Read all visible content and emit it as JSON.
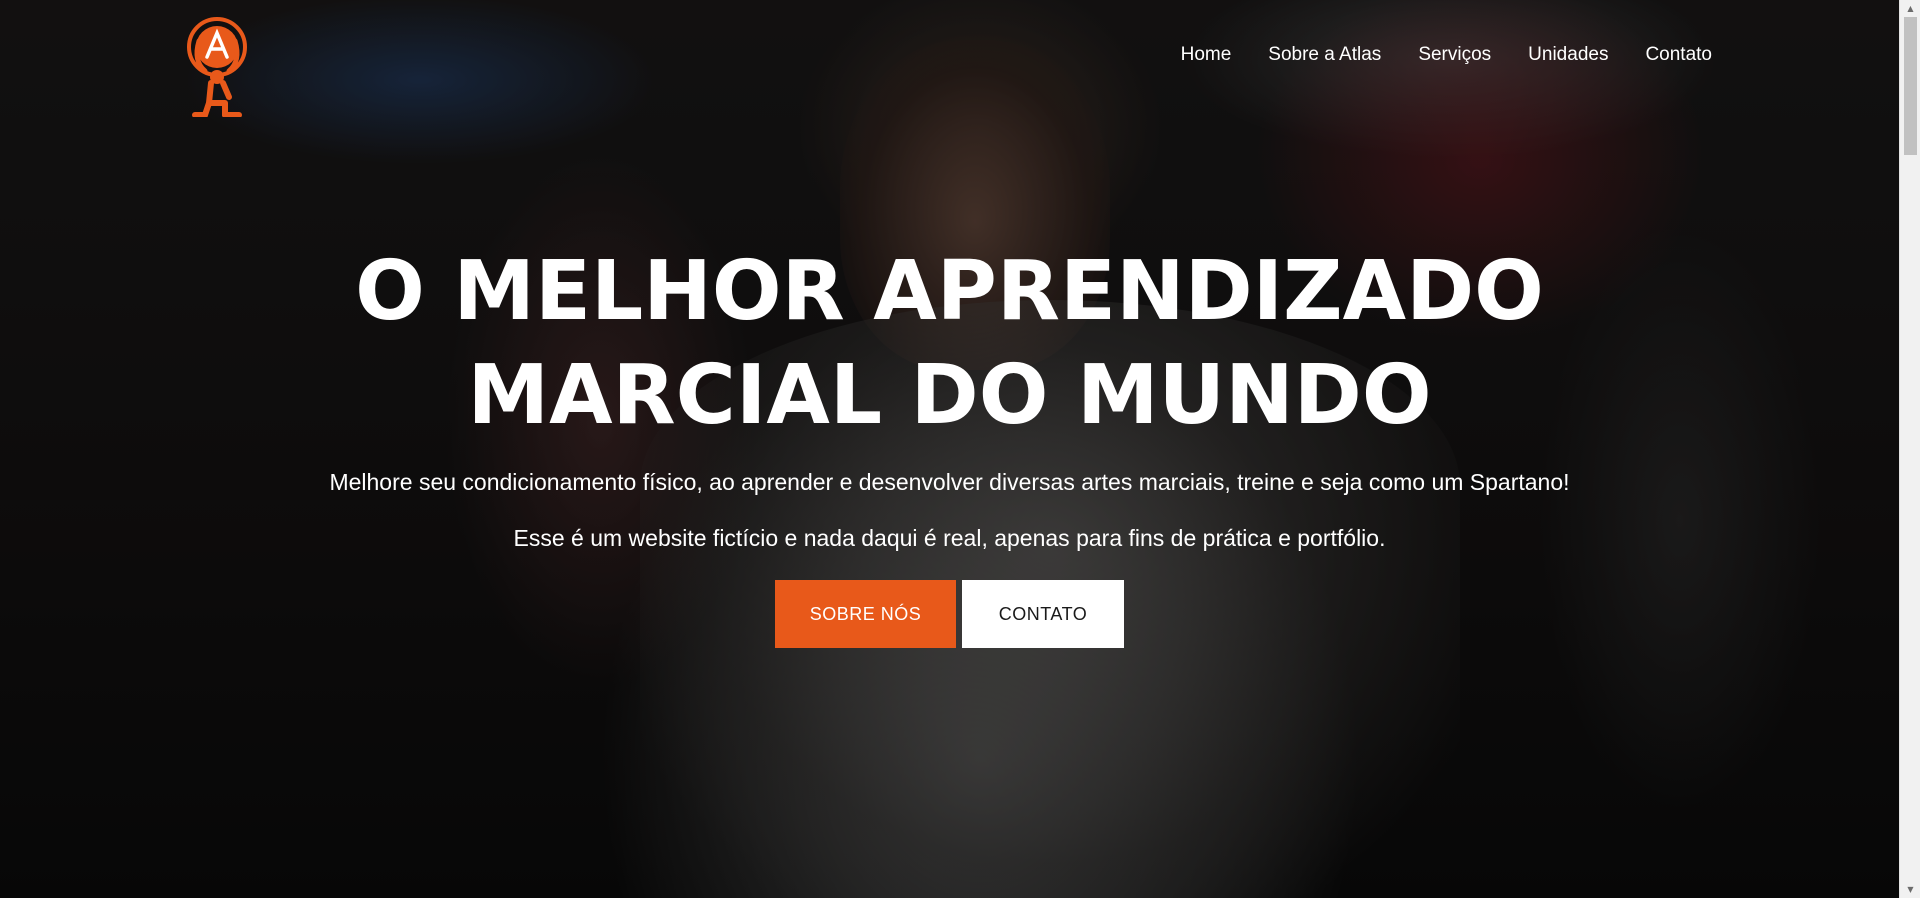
{
  "brand": {
    "logo_icon": "atlas-figure-logo-icon",
    "accent_color": "#e8591a"
  },
  "nav": {
    "items": [
      {
        "label": "Home"
      },
      {
        "label": "Sobre a Atlas"
      },
      {
        "label": "Serviços"
      },
      {
        "label": "Unidades"
      },
      {
        "label": "Contato"
      }
    ]
  },
  "hero": {
    "headline": "O MELHOR APRENDIZADO MARCIAL DO MUNDO",
    "subtitle": "Melhore seu condicionamento físico, ao aprender e desenvolver diversas artes marciais, treine e seja como um Spartano!",
    "disclaimer": "Esse é um website fictício e nada daqui é real, apenas para fins de prática e portfólio.",
    "primary_button": "SOBRE NÓS",
    "secondary_button": "CONTATO"
  }
}
